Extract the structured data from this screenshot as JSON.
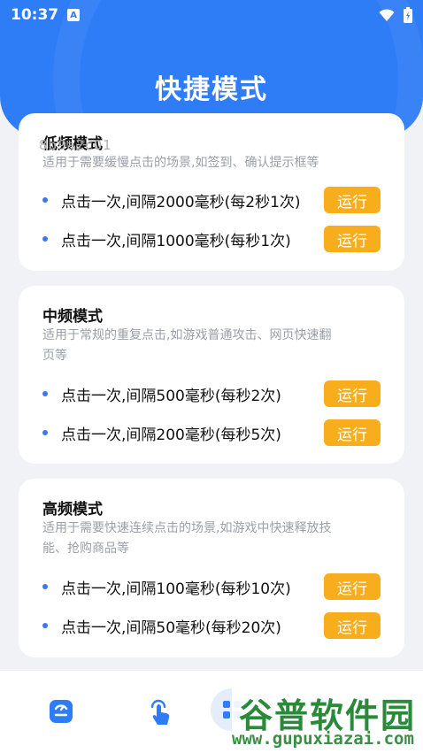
{
  "status_bar": {
    "time": "10:37",
    "notif_badge": "A"
  },
  "header": {
    "title": "快捷模式"
  },
  "overlay_code": "8b9a2c01",
  "cards": [
    {
      "title": "低频模式",
      "desc": "适用于需要缓慢点击的场景,如签到、确认提示框等",
      "rows": [
        {
          "text": "点击一次,间隔2000毫秒(每2秒1次)",
          "button": "运行"
        },
        {
          "text": "点击一次,间隔1000毫秒(每秒1次)",
          "button": "运行"
        }
      ]
    },
    {
      "title": "中频模式",
      "desc_line1": "适用于常规的重复点击,如游戏普通攻击、网页快速翻",
      "desc_line2": "页等",
      "rows": [
        {
          "text": "点击一次,间隔500毫秒(每秒2次)",
          "button": "运行"
        },
        {
          "text": "点击一次,间隔200毫秒(每秒5次)",
          "button": "运行"
        }
      ]
    },
    {
      "title": "高频模式",
      "desc_line1": "适用于需要快速连续点击的场景,如游戏中快速释放技",
      "desc_line2": "能、抢购商品等",
      "rows": [
        {
          "text": "点击一次,间隔100毫秒(每秒10次)",
          "button": "运行"
        },
        {
          "text": "点击一次,间隔50毫秒(每秒20次)",
          "button": "运行"
        }
      ]
    }
  ],
  "bottom_nav": {
    "items": [
      {
        "icon": "dashboard-icon"
      },
      {
        "icon": "tap-hand-icon"
      },
      {
        "icon": "grid-icon"
      }
    ]
  },
  "watermark": {
    "brand": "谷普软件园",
    "url": "www.gupuxiazai.com"
  },
  "colors": {
    "primary": "#2f7df6",
    "button": "#f8ad1c",
    "dot": "#3b78e8"
  }
}
